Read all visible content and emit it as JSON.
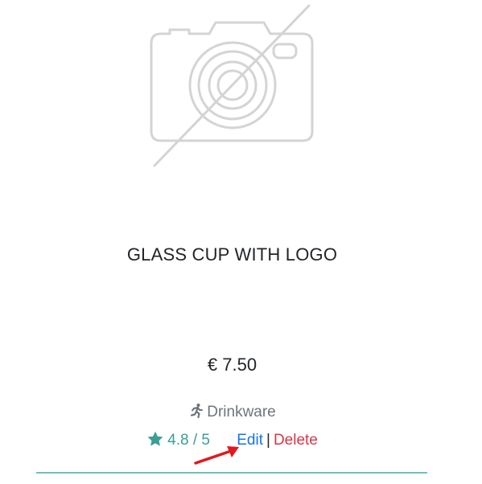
{
  "product": {
    "image_icon": "no-image-camera-icon",
    "title": "GLASS CUP WITH LOGO",
    "price": "€ 7.50",
    "category": {
      "icon": "running-person-icon",
      "label": "Drinkware"
    },
    "rating": {
      "icon": "star-icon",
      "label": "4.8 / 5"
    },
    "actions": {
      "edit_label": "Edit",
      "separator": "|",
      "delete_label": "Delete"
    }
  },
  "annotation": {
    "icon": "red-arrow-icon",
    "color": "#e0191e"
  },
  "colors": {
    "rating": "#3a9e96",
    "edit": "#1a73e8",
    "delete": "#dc3545",
    "rule": "#6cc2b6"
  }
}
